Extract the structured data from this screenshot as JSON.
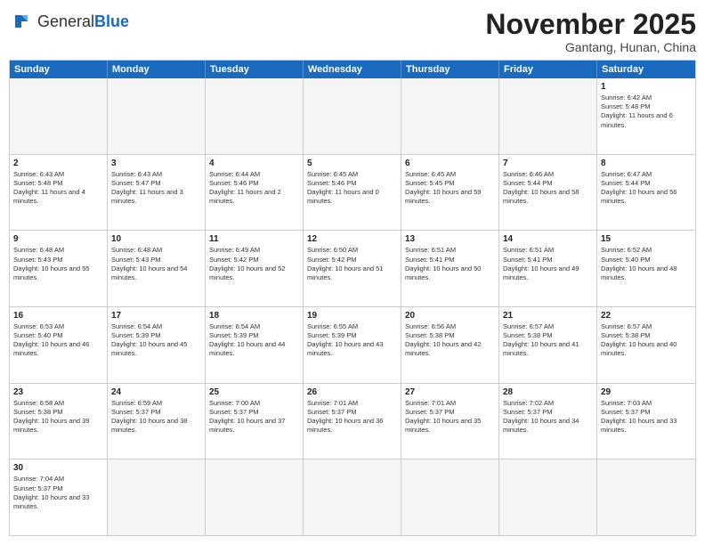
{
  "header": {
    "logo_general": "General",
    "logo_blue": "Blue",
    "month_title": "November 2025",
    "location": "Gantang, Hunan, China"
  },
  "weekdays": [
    "Sunday",
    "Monday",
    "Tuesday",
    "Wednesday",
    "Thursday",
    "Friday",
    "Saturday"
  ],
  "rows": [
    [
      {
        "day": "",
        "text": ""
      },
      {
        "day": "",
        "text": ""
      },
      {
        "day": "",
        "text": ""
      },
      {
        "day": "",
        "text": ""
      },
      {
        "day": "",
        "text": ""
      },
      {
        "day": "",
        "text": ""
      },
      {
        "day": "1",
        "text": "Sunrise: 6:42 AM\nSunset: 5:48 PM\nDaylight: 11 hours and 6 minutes."
      }
    ],
    [
      {
        "day": "2",
        "text": "Sunrise: 6:43 AM\nSunset: 5:48 PM\nDaylight: 11 hours and 4 minutes."
      },
      {
        "day": "3",
        "text": "Sunrise: 6:43 AM\nSunset: 5:47 PM\nDaylight: 11 hours and 3 minutes."
      },
      {
        "day": "4",
        "text": "Sunrise: 6:44 AM\nSunset: 5:46 PM\nDaylight: 11 hours and 2 minutes."
      },
      {
        "day": "5",
        "text": "Sunrise: 6:45 AM\nSunset: 5:46 PM\nDaylight: 11 hours and 0 minutes."
      },
      {
        "day": "6",
        "text": "Sunrise: 6:45 AM\nSunset: 5:45 PM\nDaylight: 10 hours and 59 minutes."
      },
      {
        "day": "7",
        "text": "Sunrise: 6:46 AM\nSunset: 5:44 PM\nDaylight: 10 hours and 58 minutes."
      },
      {
        "day": "8",
        "text": "Sunrise: 6:47 AM\nSunset: 5:44 PM\nDaylight: 10 hours and 56 minutes."
      }
    ],
    [
      {
        "day": "9",
        "text": "Sunrise: 6:48 AM\nSunset: 5:43 PM\nDaylight: 10 hours and 55 minutes."
      },
      {
        "day": "10",
        "text": "Sunrise: 6:48 AM\nSunset: 5:43 PM\nDaylight: 10 hours and 54 minutes."
      },
      {
        "day": "11",
        "text": "Sunrise: 6:49 AM\nSunset: 5:42 PM\nDaylight: 10 hours and 52 minutes."
      },
      {
        "day": "12",
        "text": "Sunrise: 6:50 AM\nSunset: 5:42 PM\nDaylight: 10 hours and 51 minutes."
      },
      {
        "day": "13",
        "text": "Sunrise: 6:51 AM\nSunset: 5:41 PM\nDaylight: 10 hours and 50 minutes."
      },
      {
        "day": "14",
        "text": "Sunrise: 6:51 AM\nSunset: 5:41 PM\nDaylight: 10 hours and 49 minutes."
      },
      {
        "day": "15",
        "text": "Sunrise: 6:52 AM\nSunset: 5:40 PM\nDaylight: 10 hours and 48 minutes."
      }
    ],
    [
      {
        "day": "16",
        "text": "Sunrise: 6:53 AM\nSunset: 5:40 PM\nDaylight: 10 hours and 46 minutes."
      },
      {
        "day": "17",
        "text": "Sunrise: 6:54 AM\nSunset: 5:39 PM\nDaylight: 10 hours and 45 minutes."
      },
      {
        "day": "18",
        "text": "Sunrise: 6:54 AM\nSunset: 5:39 PM\nDaylight: 10 hours and 44 minutes."
      },
      {
        "day": "19",
        "text": "Sunrise: 6:55 AM\nSunset: 5:39 PM\nDaylight: 10 hours and 43 minutes."
      },
      {
        "day": "20",
        "text": "Sunrise: 6:56 AM\nSunset: 5:38 PM\nDaylight: 10 hours and 42 minutes."
      },
      {
        "day": "21",
        "text": "Sunrise: 6:57 AM\nSunset: 5:38 PM\nDaylight: 10 hours and 41 minutes."
      },
      {
        "day": "22",
        "text": "Sunrise: 6:57 AM\nSunset: 5:38 PM\nDaylight: 10 hours and 40 minutes."
      }
    ],
    [
      {
        "day": "23",
        "text": "Sunrise: 6:58 AM\nSunset: 5:38 PM\nDaylight: 10 hours and 39 minutes."
      },
      {
        "day": "24",
        "text": "Sunrise: 6:59 AM\nSunset: 5:37 PM\nDaylight: 10 hours and 38 minutes."
      },
      {
        "day": "25",
        "text": "Sunrise: 7:00 AM\nSunset: 5:37 PM\nDaylight: 10 hours and 37 minutes."
      },
      {
        "day": "26",
        "text": "Sunrise: 7:01 AM\nSunset: 5:37 PM\nDaylight: 10 hours and 36 minutes."
      },
      {
        "day": "27",
        "text": "Sunrise: 7:01 AM\nSunset: 5:37 PM\nDaylight: 10 hours and 35 minutes."
      },
      {
        "day": "28",
        "text": "Sunrise: 7:02 AM\nSunset: 5:37 PM\nDaylight: 10 hours and 34 minutes."
      },
      {
        "day": "29",
        "text": "Sunrise: 7:03 AM\nSunset: 5:37 PM\nDaylight: 10 hours and 33 minutes."
      }
    ],
    [
      {
        "day": "30",
        "text": "Sunrise: 7:04 AM\nSunset: 5:37 PM\nDaylight: 10 hours and 33 minutes."
      },
      {
        "day": "",
        "text": ""
      },
      {
        "day": "",
        "text": ""
      },
      {
        "day": "",
        "text": ""
      },
      {
        "day": "",
        "text": ""
      },
      {
        "day": "",
        "text": ""
      },
      {
        "day": "",
        "text": ""
      }
    ]
  ]
}
